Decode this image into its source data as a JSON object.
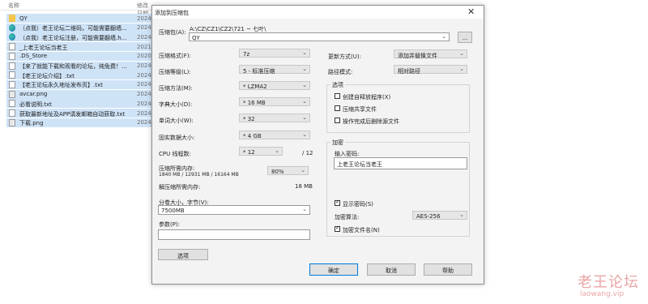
{
  "explorer": {
    "header": {
      "name": "名称",
      "date": "修改日期"
    },
    "rows": [
      {
        "name": "QY",
        "date": "2024",
        "icon": "folder-icon"
      },
      {
        "name": "（点我）老王论坛二维码，可能需要翻墙...",
        "date": "2024",
        "icon": "edge-icon"
      },
      {
        "name": "（点我）老王论坛注册，可能需要翻墙.h...",
        "date": "2024",
        "icon": "edge-icon"
      },
      {
        "name": "_上老王论坛当老王",
        "date": "2021",
        "icon": "file-icon"
      },
      {
        "name": ".DS_Store",
        "date": "2020",
        "icon": "file-icon"
      },
      {
        "name": "【来了就能下载和观看的论坛，纯免费！...",
        "date": "2024",
        "icon": "file-icon"
      },
      {
        "name": "【老王论坛介绍】.txt",
        "date": "2024",
        "icon": "file-icon"
      },
      {
        "name": "【老王论坛永久地址发布页】.txt",
        "date": "2024",
        "icon": "file-icon"
      },
      {
        "name": "avcar.png",
        "date": "2024",
        "icon": "image-icon"
      },
      {
        "name": "必看说明.txt",
        "date": "2024",
        "icon": "file-icon"
      },
      {
        "name": "获取最新地址及APP请发邮箱自动获取.txt",
        "date": "2024",
        "icon": "file-icon"
      },
      {
        "name": "下载.png",
        "date": "2024",
        "icon": "image-icon"
      }
    ]
  },
  "dialog": {
    "title": "添加到压缩包",
    "close": "✕",
    "archive_label": "压缩包(A):",
    "archive_path": "A:\\CZ\\CZ1\\CZ2\\721 ~ 七叶\\",
    "archive_name": "QY",
    "browse_button": "...",
    "format_label": "压缩格式(F):",
    "format_value": "7z",
    "level_label": "压缩等级(L):",
    "level_value": "5 - 标准压缩",
    "method_label": "压缩方法(M):",
    "method_value": "* LZMA2",
    "dict_label": "字典大小(D):",
    "dict_value": "* 16 MB",
    "word_label": "单词大小(W):",
    "word_value": "* 32",
    "solid_label": "固实数据大小:",
    "solid_value": "* 4 GB",
    "cpu_label": "CPU 线程数:",
    "cpu_value": "* 12",
    "cpu_max": "/ 12",
    "mem_comp_label": "压缩所需内存:",
    "mem_comp_detail": "1840 MB / 12931 MB / 16164 MB",
    "mem_percent": "80%",
    "mem_decomp_label": "解压缩所需内存:",
    "mem_decomp_value": "18 MB",
    "split_label": "分卷大小，字节(V):",
    "split_value": "7500MB",
    "params_label": "参数(P):",
    "params_value": "",
    "options_button": "选项",
    "update_label": "更新方式(U):",
    "update_value": "添加并替换文件",
    "path_label": "路径模式:",
    "path_value": "相对路径",
    "options_group": "选项",
    "opt_sfx": "创建自释放程序(X)",
    "opt_shared": "压缩共享文件",
    "opt_delete": "操作完成后删除源文件",
    "encrypt_group": "加密",
    "password_label": "输入密码:",
    "password_value": "上老王论坛当老王",
    "show_password": "显示密码(S)",
    "enc_method_label": "加密算法:",
    "enc_method_value": "AES-256",
    "encrypt_names": "加密文件名(N)",
    "ok_button": "确定",
    "cancel_button": "取消",
    "help_button": "帮助"
  },
  "watermark": {
    "title": "老王论坛",
    "url": "laowang.vip"
  }
}
